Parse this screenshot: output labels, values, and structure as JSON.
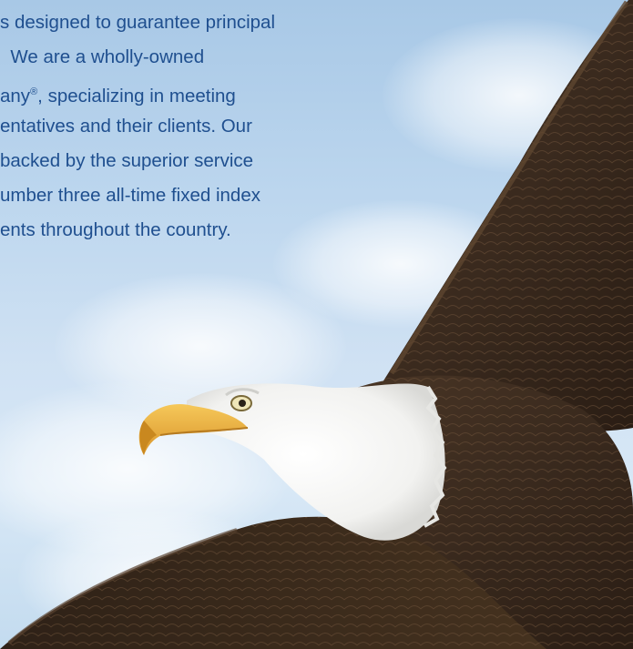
{
  "intro": {
    "line1": "s designed to guarantee principal",
    "line2": "  We are a wholly-owned",
    "line3_pre": "any",
    "line3_mark": "®",
    "line3_post": ", specializing in meeting",
    "line4": "entatives and their clients. Our",
    "line5": "backed by the superior service",
    "line6": "umber three all-time fixed index",
    "line7": "ents throughout the country."
  },
  "colors": {
    "text": "#1f4f8f",
    "sky_top": "#a8c8e6",
    "sky_bottom": "#d8e8f6",
    "feather_dark": "#3a2a1f",
    "beak": "#f0b43c"
  },
  "image": {
    "subject_icon": "eagle-icon"
  }
}
